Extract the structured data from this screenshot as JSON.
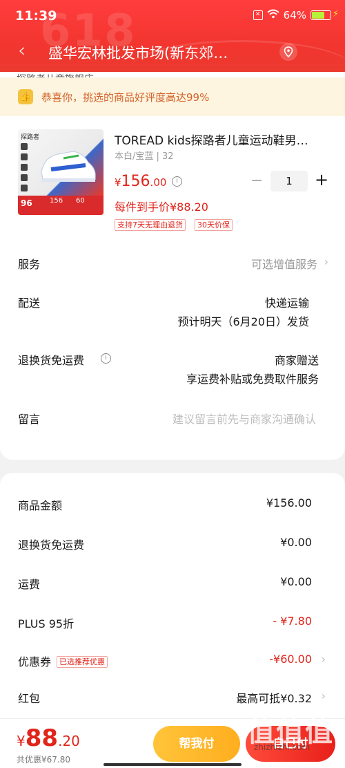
{
  "status_bar": {
    "time": "11:39",
    "battery": "64%"
  },
  "nav": {
    "title": "盛华宏林批发市场(新东郊…"
  },
  "header_deco": "618",
  "peek_text": "探路者儿童旗舰店",
  "banner": {
    "text": "恭喜你，挑选的商品好评度高达99%"
  },
  "product": {
    "title": "TOREAD kids探路者儿童运动鞋男…",
    "spec": "本白/宝蓝 | 32",
    "price_symbol": "¥",
    "price_int": "156",
    "price_dec": ".00",
    "quantity": "1",
    "hand_price": "每件到手价¥88.20",
    "tags": [
      "支持7天无理由退货",
      "30天价保"
    ],
    "image": {
      "brand": "探路者",
      "badge_price": "96",
      "badge_orig": "156",
      "badge_coupon": "60"
    }
  },
  "rows": {
    "service": {
      "label": "服务",
      "value": "可选增值服务"
    },
    "delivery": {
      "label": "配送",
      "value": "快递运输",
      "sub": "预计明天（6月20日）发货"
    },
    "return_freight": {
      "label": "退换货免运费",
      "value": "商家赠送",
      "sub": "享运费补贴或免费取件服务"
    },
    "message": {
      "label": "留言",
      "placeholder": "建议留言前先与商家沟通确认"
    }
  },
  "prices": {
    "goods": {
      "label": "商品金额",
      "value": "¥156.00"
    },
    "return_fee": {
      "label": "退换货免运费",
      "value": "¥0.00"
    },
    "freight": {
      "label": "运费",
      "value": "¥0.00"
    },
    "plus": {
      "label": "PLUS 95折",
      "value": "- ¥7.80"
    },
    "coupon": {
      "label": "优惠券",
      "tag": "已选推荐优惠",
      "value": "-¥60.00"
    },
    "redpack": {
      "label": "红包",
      "value": "最高可抵¥0.32"
    }
  },
  "bottom": {
    "total_symbol": "¥",
    "total_int": "88",
    "total_dec": ".20",
    "saved": "共优惠¥67.80",
    "help_label": "帮我付",
    "pay_label": "自己付"
  },
  "watermark": {
    "big": "值值值",
    "small": "zhizhizhi.com"
  },
  "colors": {
    "header": "#f2352f",
    "accent": "#e1251b",
    "help": "#ffb52a",
    "banner_bg": "#fdf5df"
  }
}
